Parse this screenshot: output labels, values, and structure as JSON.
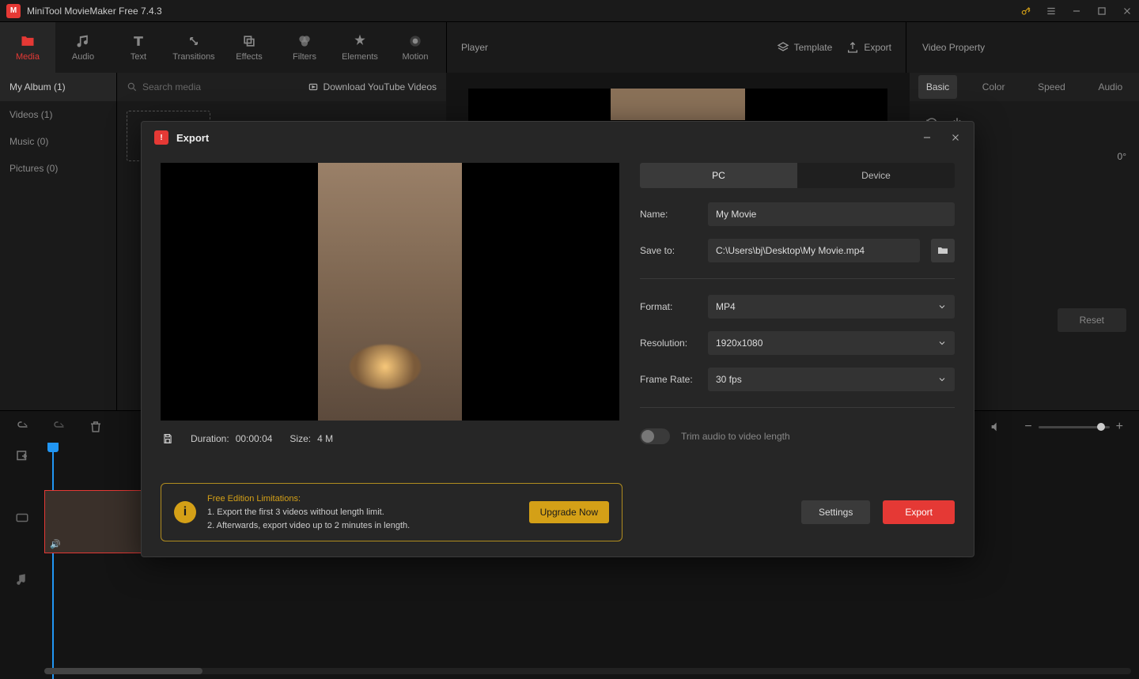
{
  "app": {
    "title": "MiniTool MovieMaker Free 7.4.3"
  },
  "toolbar_tabs": [
    {
      "label": "Media",
      "icon": "folder-icon"
    },
    {
      "label": "Audio",
      "icon": "music-note-icon"
    },
    {
      "label": "Text",
      "icon": "text-icon"
    },
    {
      "label": "Transitions",
      "icon": "transition-icon"
    },
    {
      "label": "Effects",
      "icon": "effects-icon"
    },
    {
      "label": "Filters",
      "icon": "filters-icon"
    },
    {
      "label": "Elements",
      "icon": "elements-icon"
    },
    {
      "label": "Motion",
      "icon": "motion-icon"
    }
  ],
  "player": {
    "label": "Player",
    "template_label": "Template",
    "export_label": "Export"
  },
  "video_property": {
    "label": "Video Property",
    "tabs": [
      "Basic",
      "Color",
      "Speed",
      "Audio"
    ],
    "rotation_value": "0°",
    "reset_label": "Reset"
  },
  "sidebar": {
    "header": "My Album (1)",
    "items": [
      {
        "label": "Videos (1)"
      },
      {
        "label": "Music (0)"
      },
      {
        "label": "Pictures (0)"
      }
    ]
  },
  "media_panel": {
    "search_placeholder": "Search media",
    "download_label": "Download YouTube Videos"
  },
  "export_modal": {
    "title": "Export",
    "tabs": {
      "pc": "PC",
      "device": "Device"
    },
    "fields": {
      "name_label": "Name:",
      "name_value": "My Movie",
      "saveto_label": "Save to:",
      "saveto_value": "C:\\Users\\bj\\Desktop\\My Movie.mp4",
      "format_label": "Format:",
      "format_value": "MP4",
      "resolution_label": "Resolution:",
      "resolution_value": "1920x1080",
      "framerate_label": "Frame Rate:",
      "framerate_value": "30 fps",
      "trim_label": "Trim audio to video length"
    },
    "meta": {
      "duration_label": "Duration:",
      "duration_value": "00:00:04",
      "size_label": "Size:",
      "size_value": "4 M"
    },
    "limitations": {
      "title": "Free Edition Limitations:",
      "line1": "1. Export the first 3 videos without length limit.",
      "line2": "2. Afterwards, export video up to 2 minutes in length.",
      "upgrade_label": "Upgrade Now"
    },
    "settings_label": "Settings",
    "export_label": "Export"
  }
}
